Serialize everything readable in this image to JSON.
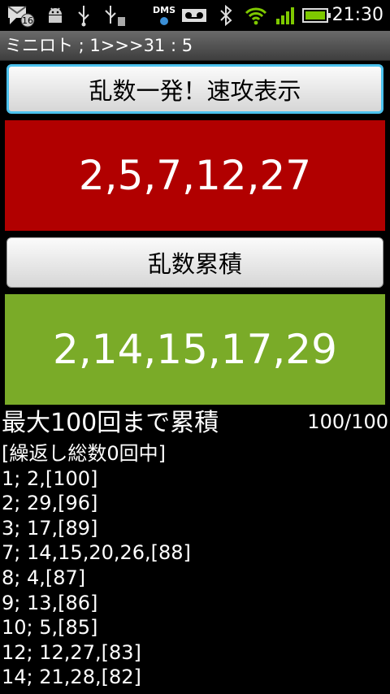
{
  "status_bar": {
    "icons": [
      {
        "name": "sms-notification-icon",
        "badge": "16"
      },
      {
        "name": "android-debug-icon"
      },
      {
        "name": "usb-icon"
      },
      {
        "name": "usb-storage-icon"
      },
      {
        "name": "dms-icon",
        "label": "DMS"
      },
      {
        "name": "voicemail-icon"
      },
      {
        "name": "bluetooth-icon"
      },
      {
        "name": "wifi-icon"
      },
      {
        "name": "signal-icon"
      },
      {
        "name": "battery-icon"
      }
    ],
    "time": "21:30"
  },
  "title_bar": {
    "title": "ミニロト ; 1>>>31 : 5"
  },
  "buttons": {
    "instant": "乱数一発！速攻表示",
    "accumulate": "乱数累積"
  },
  "results": {
    "instant_numbers": "2,5,7,12,27",
    "accumulated_numbers": "2,14,15,17,29"
  },
  "summary": {
    "label": "最大100回まで累積",
    "counter": "100/100"
  },
  "history": {
    "header": "[繰返し総数0回中]",
    "rows": [
      "1; 2,[100]",
      "2; 29,[96]",
      "3; 17,[89]",
      "7; 14,15,20,26,[88]",
      "8; 4,[87]",
      "9; 13,[86]",
      "10; 5,[85]",
      "12; 12,27,[83]",
      "14; 21,28,[82]"
    ]
  },
  "colors": {
    "red_panel": "#b10000",
    "green_panel": "#7aab28",
    "focus_border": "#4cc2ee",
    "signal_green": "#7ec800"
  }
}
